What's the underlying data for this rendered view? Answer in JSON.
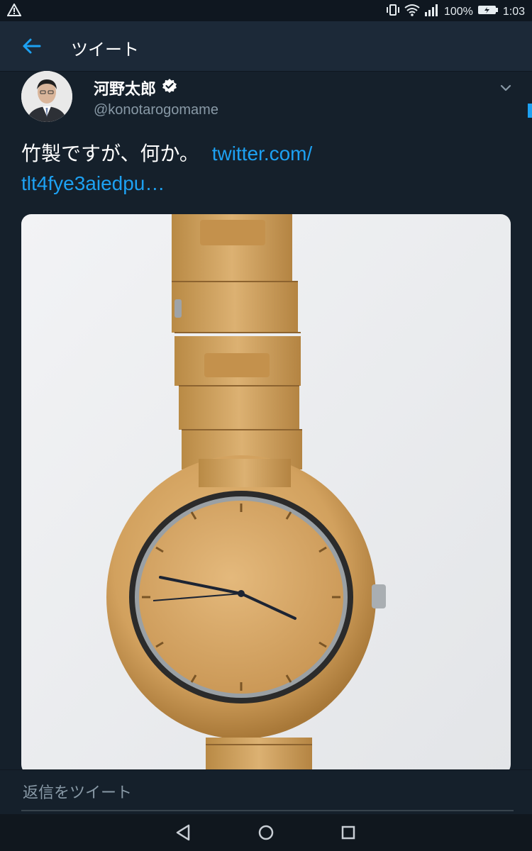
{
  "status_bar": {
    "battery_percent": "100%",
    "time": "1:03",
    "icons": [
      "warning-icon",
      "vibrate-icon",
      "wifi-icon",
      "signal-icon",
      "battery-icon"
    ]
  },
  "header": {
    "title": "ツイート",
    "back_icon": "back-arrow-icon"
  },
  "tweet": {
    "author": {
      "display_name": "河野太郎",
      "handle": "@konotarogomame",
      "verified": true
    },
    "text": "竹製ですが、何か。",
    "link_line1": "twitter.com/",
    "link_line2": "tlt4fye3aiedpu…",
    "media": {
      "kind": "photo",
      "subject": "bamboo-wristwatch"
    }
  },
  "reply": {
    "placeholder": "返信をツイート"
  },
  "navigation": {
    "buttons": [
      "back-triangle-icon",
      "home-circle-icon",
      "recents-square-icon"
    ]
  },
  "colors": {
    "background": "#15202b",
    "header": "#1c2938",
    "accent": "#1da1f2",
    "secondary_text": "#8899a6"
  }
}
